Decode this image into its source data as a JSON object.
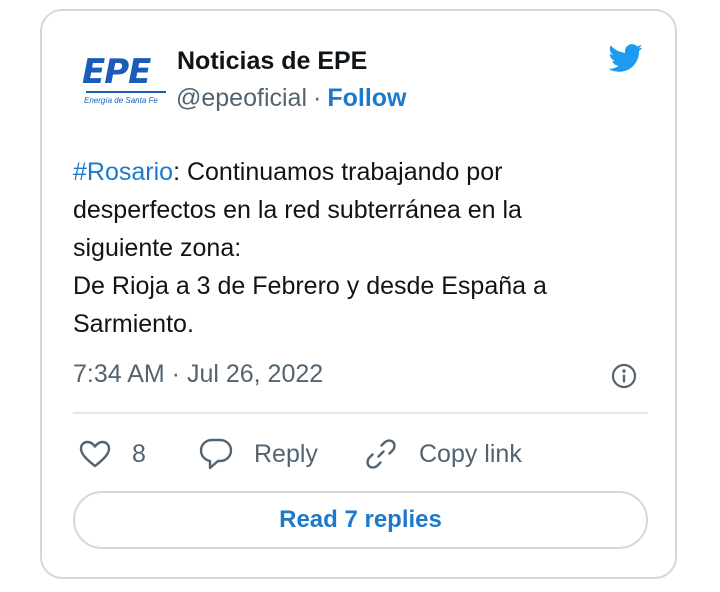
{
  "account": {
    "logo_text": "EPE",
    "logo_subtitle": "Energía de Santa Fe",
    "name": "Noticias de EPE",
    "handle": "@epeoficial",
    "separator": "·",
    "follow_label": "Follow"
  },
  "tweet": {
    "hashtag": "#Rosario",
    "line1_rest": ": Continuamos trabajando por",
    "line2": "desperfectos en la red subterránea en la",
    "line3": "siguiente zona:",
    "line4": "De Rioja a 3 de Febrero y desde España a",
    "line5": "Sarmiento.",
    "timestamp": "7:34 AM · Jul 26, 2022"
  },
  "actions": {
    "like_count": "8",
    "reply_label": "Reply",
    "copy_label": "Copy link",
    "read_replies_label": "Read 7 replies"
  },
  "colors": {
    "accent": "#1d7acb",
    "twitter_blue": "#1d9bf0",
    "brand_blue": "#1b5cb8",
    "muted_text": "#536471",
    "border": "#cfd9de"
  },
  "icons": [
    "twitter-bird-icon",
    "info-icon",
    "heart-icon",
    "reply-bubble-icon",
    "link-icon"
  ]
}
